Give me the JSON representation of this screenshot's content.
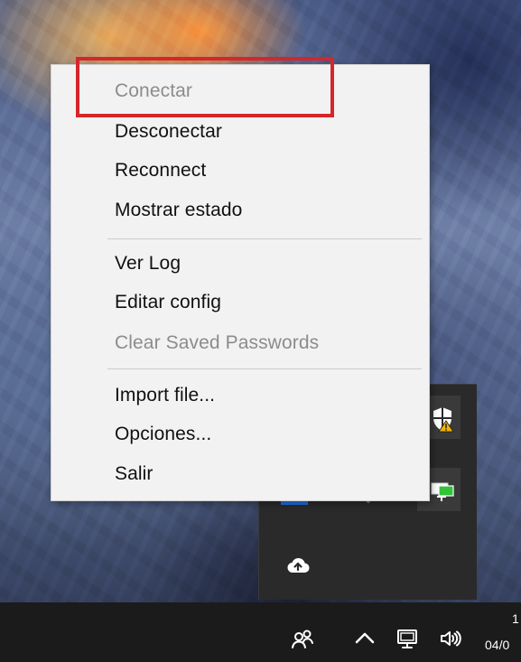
{
  "context_menu": {
    "items": [
      {
        "label": "Conectar",
        "disabled": true
      },
      {
        "label": "Desconectar",
        "disabled": false
      },
      {
        "label": "Reconnect",
        "disabled": false
      },
      {
        "label": "Mostrar estado",
        "disabled": false
      },
      {
        "label": "Ver Log",
        "disabled": false
      },
      {
        "label": "Editar config",
        "disabled": false
      },
      {
        "label": "Clear Saved Passwords",
        "disabled": true
      },
      {
        "label": "Import file...",
        "disabled": false
      },
      {
        "label": "Opciones...",
        "disabled": false
      },
      {
        "label": "Salir",
        "disabled": false
      }
    ]
  },
  "taskbar": {
    "clock_time_partial": "1",
    "clock_date_partial": "04/0"
  },
  "colors": {
    "highlight": "#d5262b",
    "menu_background": "#f2f2f2",
    "disabled_text": "#8c8c8c",
    "taskbar": "#1b1b1b",
    "flyout": "#2a2a2a"
  },
  "icons": {
    "overflow_tray": [
      "shield-warning-icon",
      "network-monitor-icon",
      "cloud-upload-icon"
    ],
    "taskbar_tray": [
      "people-icon",
      "chevron-up-icon",
      "network-icon",
      "volume-icon"
    ]
  }
}
